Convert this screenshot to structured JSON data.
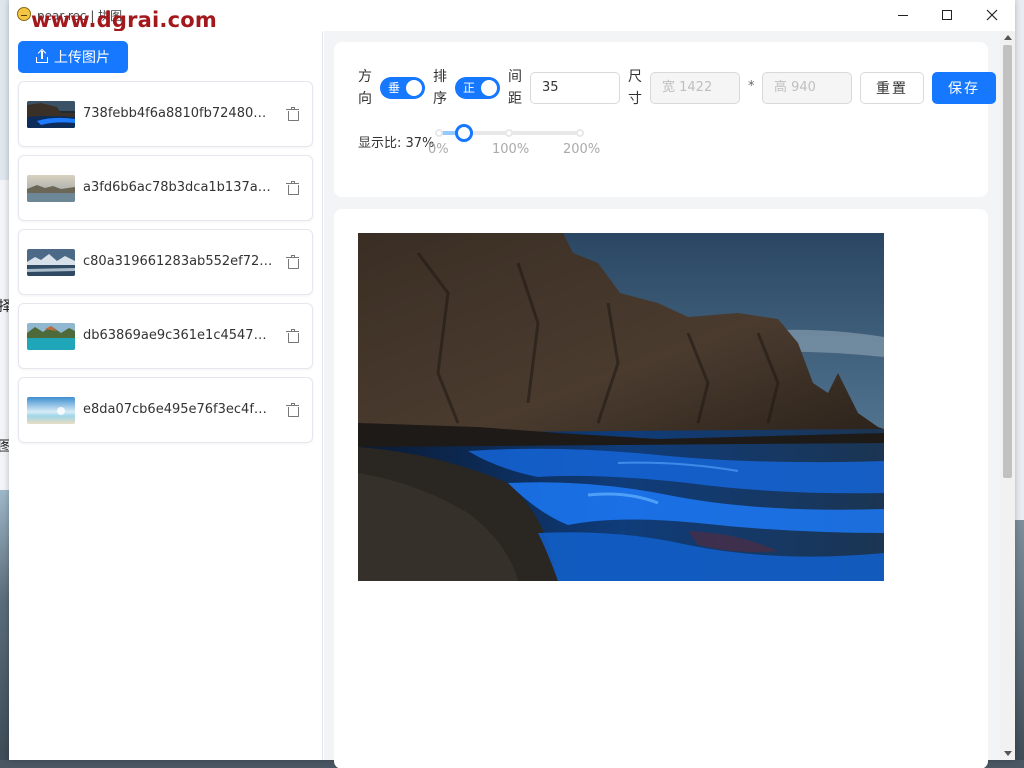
{
  "window": {
    "title": "pear-rec | 拼图",
    "watermark": "www.dgrai.com"
  },
  "sidebar": {
    "upload_label": "上传图片",
    "files": [
      {
        "name": "738febb4f6a8810fb7248056..."
      },
      {
        "name": "a3fd6b6ac78b3dca1b137a80..."
      },
      {
        "name": "c80a319661283ab552ef72cd..."
      },
      {
        "name": "db63869ae9c361e1c45472a..."
      },
      {
        "name": "e8da07cb6e495e76f3ec4fd3..."
      }
    ]
  },
  "toolbar": {
    "direction_label": "方向",
    "direction_value": "垂",
    "sort_label": "排序",
    "sort_value": "正",
    "gap_label": "间距",
    "gap_value": "35",
    "size_label": "尺寸",
    "width_placeholder": "宽 1422",
    "height_placeholder": "高 940",
    "times": "*",
    "reset_label": "重置",
    "save_label": "保存",
    "ratio_label": "显示比: 37%",
    "ratio_value": 0.37,
    "marks": [
      "0%",
      "100%",
      "200%"
    ]
  },
  "colors": {
    "primary": "#1677ff",
    "watermark": "#a3181c"
  },
  "desktop_glyphs": [
    "择",
    "图"
  ]
}
